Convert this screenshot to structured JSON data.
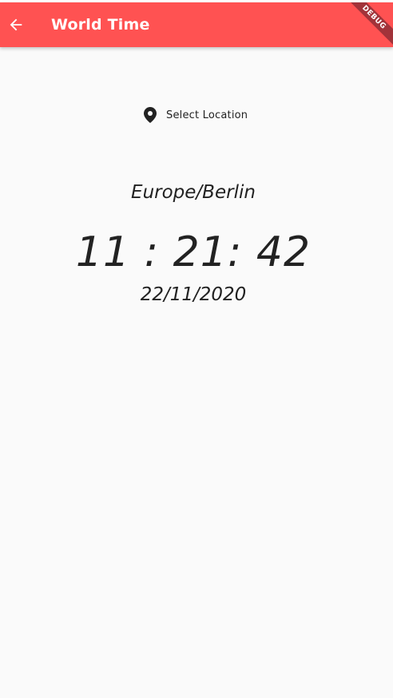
{
  "app_bar": {
    "title": "World Time",
    "back_icon": "arrow-back-icon",
    "background_color": "#ff5252"
  },
  "debug_banner": {
    "label": "DEBUG",
    "color": "#a1333a"
  },
  "select_location": {
    "icon": "location-pin-icon",
    "label": "Select Location"
  },
  "location": "Europe/Berlin",
  "time": "11 : 21: 42",
  "date": "22/11/2020"
}
